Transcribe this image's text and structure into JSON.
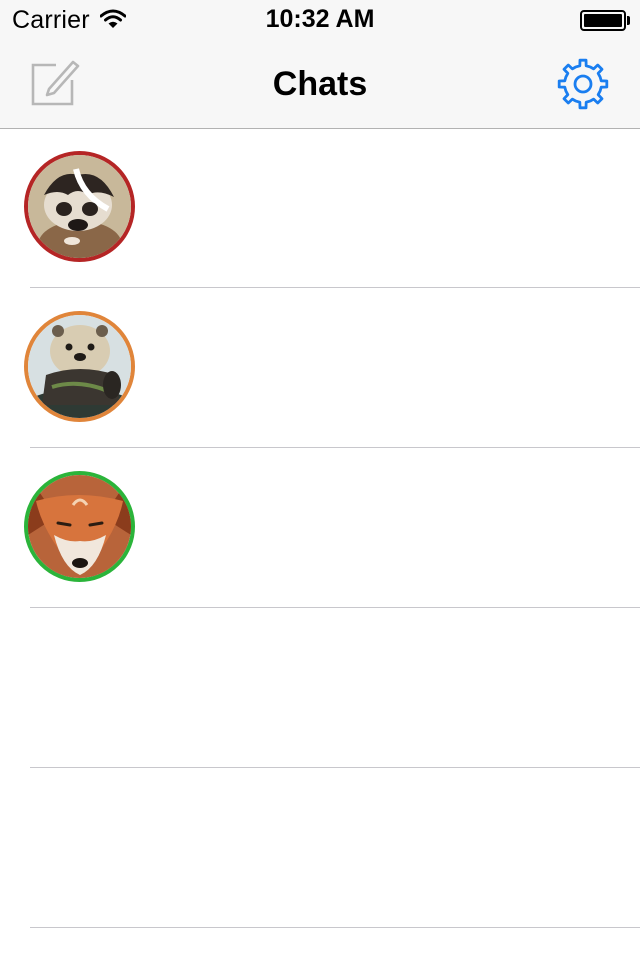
{
  "status_bar": {
    "carrier": "Carrier",
    "time": "10:32 AM",
    "wifi_icon": "wifi-icon",
    "battery_icon": "battery-icon"
  },
  "nav_bar": {
    "title": "Chats",
    "left_icon": "compose-icon",
    "right_icon": "gear-icon",
    "accent_color": "#1a7ef0",
    "disabled_icon_color": "#b7b7b7"
  },
  "chats": [
    {
      "avatar": "badger-avatar",
      "ring_color": "#b52525"
    },
    {
      "avatar": "otter-avatar",
      "ring_color": "#e0853a"
    },
    {
      "avatar": "fox-avatar",
      "ring_color": "#2bb43a"
    },
    {
      "avatar": null
    },
    {
      "avatar": null
    }
  ]
}
